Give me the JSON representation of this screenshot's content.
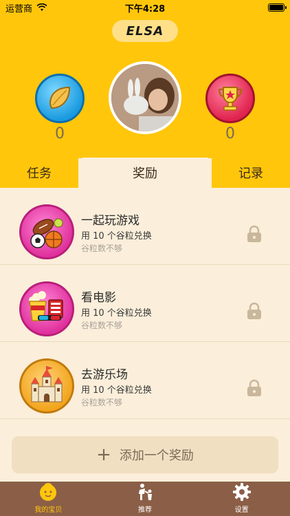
{
  "status": {
    "carrier": "运营商",
    "time": "下午4:28"
  },
  "profile": {
    "name": "ELSA",
    "grain_count": "0",
    "trophy_count": "0"
  },
  "tabs": [
    {
      "label": "任务"
    },
    {
      "label": "奖励"
    },
    {
      "label": "记录"
    }
  ],
  "rewards": [
    {
      "title": "一起玩游戏",
      "cost": "用 10 个谷粒兑换",
      "hint": "谷粒数不够",
      "icon": "sports-balls-icon",
      "color": "#e0329d"
    },
    {
      "title": "看电影",
      "cost": "用 10 个谷粒兑换",
      "hint": "谷粒数不够",
      "icon": "popcorn-3d-glasses-icon",
      "color": "#e0329d"
    },
    {
      "title": "去游乐场",
      "cost": "用 10 个谷粒兑换",
      "hint": "谷粒数不够",
      "icon": "castle-icon",
      "color": "#f2a51d"
    }
  ],
  "add_button": {
    "plus": "+",
    "label": "添加一个奖励"
  },
  "tabbar": [
    {
      "label": "我的宝贝",
      "icon": "baby-face-icon",
      "active": true
    },
    {
      "label": "推荐",
      "icon": "family-icon",
      "active": false
    },
    {
      "label": "设置",
      "icon": "gear-icon",
      "active": false
    }
  ],
  "colors": {
    "accent": "#FFC60B",
    "background": "#FBEEDA",
    "tabbar": "#8B5F47"
  }
}
